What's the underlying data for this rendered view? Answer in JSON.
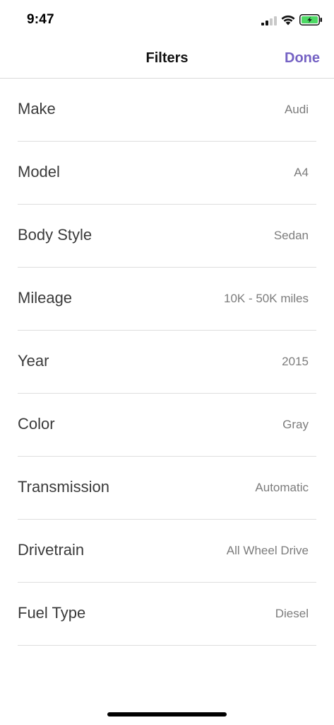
{
  "status_bar": {
    "time": "9:47",
    "icons": [
      "cellular-signal-icon",
      "wifi-icon",
      "battery-charging-icon"
    ],
    "battery_color": "#4cd964"
  },
  "nav": {
    "title": "Filters",
    "done_label": "Done",
    "accent_color": "#7562c4"
  },
  "filters": [
    {
      "label": "Make",
      "value": "Audi"
    },
    {
      "label": "Model",
      "value": "A4"
    },
    {
      "label": "Body Style",
      "value": "Sedan"
    },
    {
      "label": "Mileage",
      "value": "10K - 50K miles"
    },
    {
      "label": "Year",
      "value": "2015"
    },
    {
      "label": "Color",
      "value": "Gray"
    },
    {
      "label": "Transmission",
      "value": "Automatic"
    },
    {
      "label": "Drivetrain",
      "value": "All Wheel Drive"
    },
    {
      "label": "Fuel Type",
      "value": "Diesel"
    }
  ]
}
